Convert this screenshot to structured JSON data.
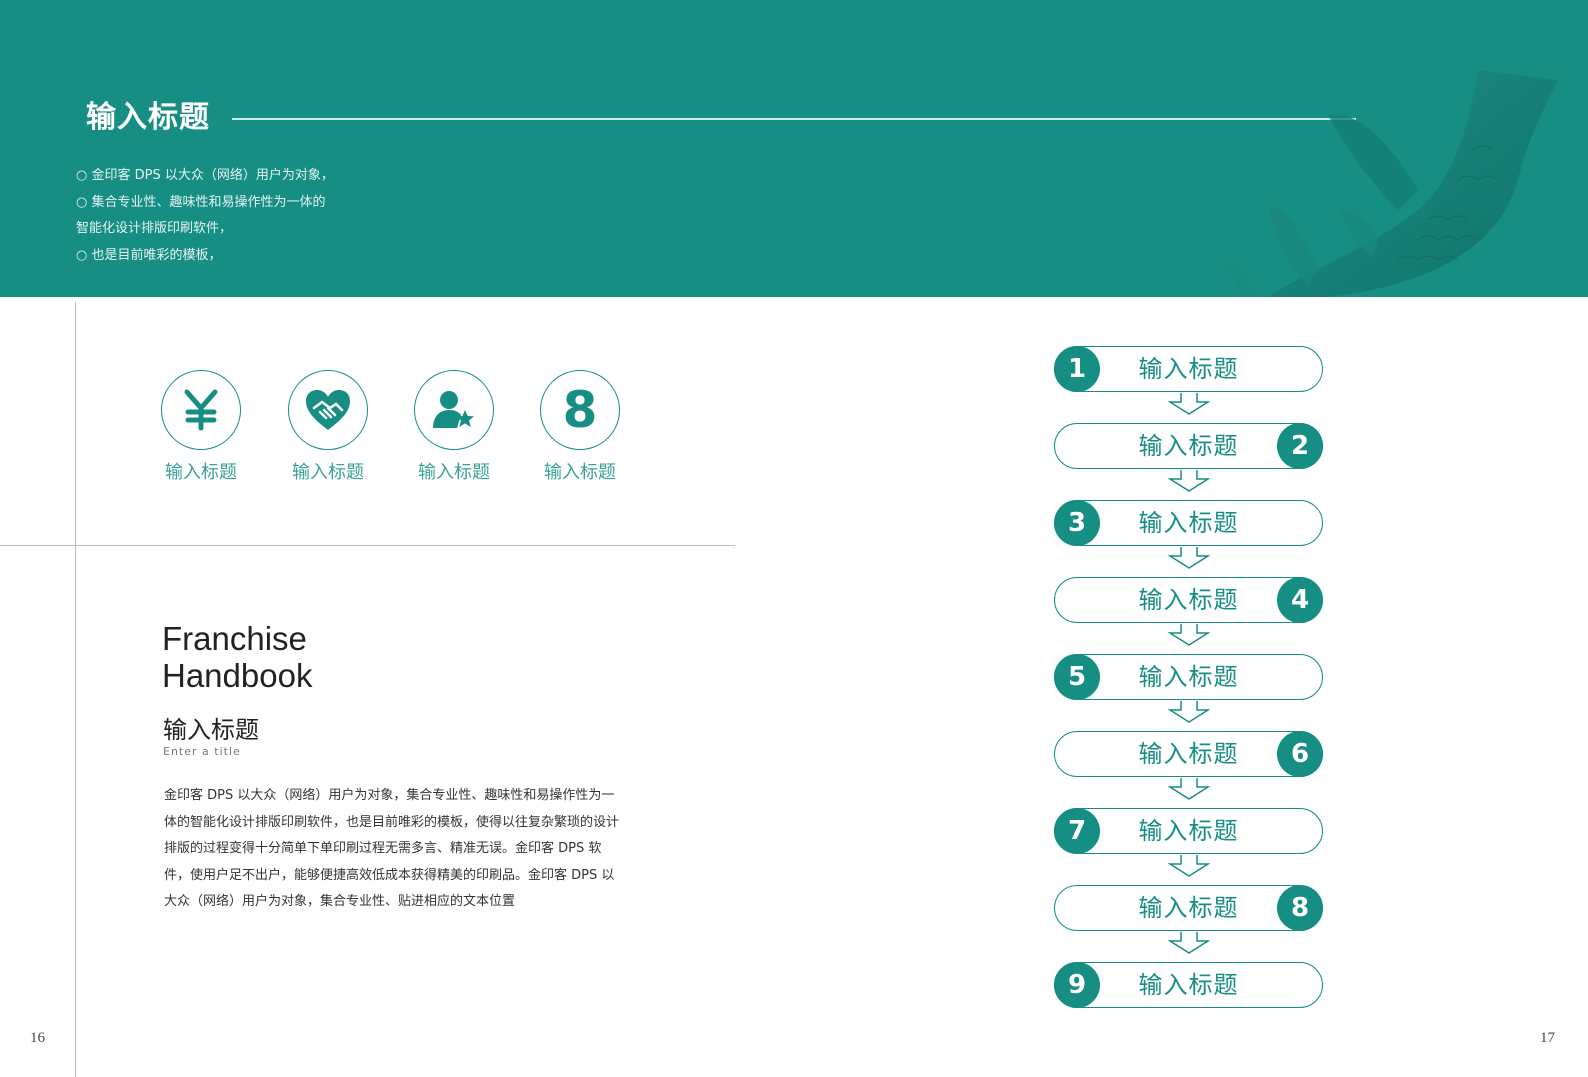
{
  "header": {
    "title": "输入标题",
    "bullets": [
      "○ 金印客 DPS 以大众（网络）用户为对象，",
      "○ 集合专业性、趣味性和易操作性为一体的",
      "智能化设计排版印刷软件，",
      "○ 也是目前唯彩的模板，"
    ]
  },
  "icons": [
    {
      "icon": "yen-icon",
      "label": "输入标题"
    },
    {
      "icon": "handshake-heart-icon",
      "label": "输入标题"
    },
    {
      "icon": "user-star-icon",
      "label": "输入标题"
    },
    {
      "icon": "number-eight-icon",
      "glyph": "8",
      "label": "输入标题"
    }
  ],
  "left": {
    "heading_line1": "Franchise",
    "heading_line2": "Handbook",
    "subtitle": "输入标题",
    "subtitle_en": "Enter  a  title",
    "body": "金印客 DPS 以大众（网络）用户为对象，集合专业性、趣味性和易操作性为一体的智能化设计排版印刷软件，也是目前唯彩的模板，使得以往复杂繁琐的设计排版的过程变得十分简单下单印刷过程无需多言、精准无误。金印客 DPS 软件，使用户足不出户，能够便捷高效低成本获得精美的印刷品。金印客 DPS 以大众（网络）用户为对象，集合专业性、贴进相应的文本位置"
  },
  "steps": [
    {
      "num": "1",
      "label": "输入标题",
      "side": "left"
    },
    {
      "num": "2",
      "label": "输入标题",
      "side": "right"
    },
    {
      "num": "3",
      "label": "输入标题",
      "side": "left"
    },
    {
      "num": "4",
      "label": "输入标题",
      "side": "right"
    },
    {
      "num": "5",
      "label": "输入标题",
      "side": "left"
    },
    {
      "num": "6",
      "label": "输入标题",
      "side": "right"
    },
    {
      "num": "7",
      "label": "输入标题",
      "side": "left"
    },
    {
      "num": "8",
      "label": "输入标题",
      "side": "right"
    },
    {
      "num": "9",
      "label": "输入标题",
      "side": "left"
    }
  ],
  "page_numbers": {
    "left": "16",
    "right": "17"
  },
  "colors": {
    "accent": "#178e84",
    "accent_light": "#3aa198"
  }
}
